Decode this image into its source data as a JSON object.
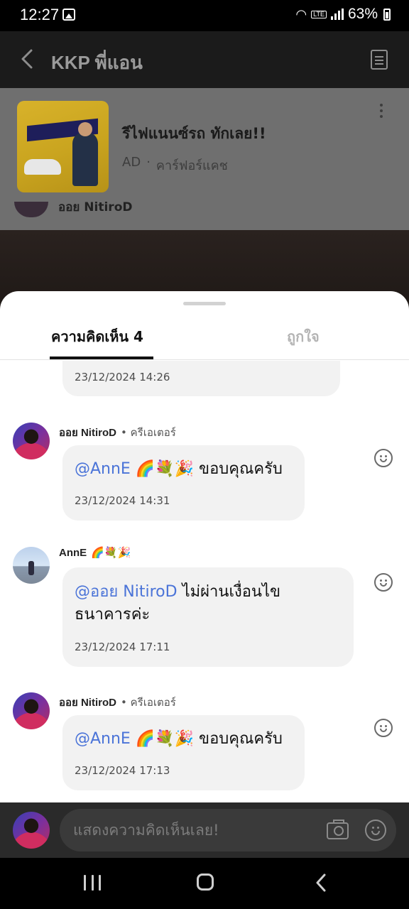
{
  "status_bar": {
    "time": "12:27",
    "network": "LTE",
    "battery": "63%"
  },
  "header": {
    "title": "KKP พี่แอน"
  },
  "ad": {
    "title": "รีไฟแนนซ์รถ ทักเลย!!",
    "label": "AD",
    "separator": "·",
    "advertiser": "คาร์ฟอร์แคช",
    "peek_name": "ออย NitiroD"
  },
  "sheet": {
    "tabs": [
      {
        "label": "ความคิดเห็น 4",
        "active": true
      },
      {
        "label": "ถูกใจ",
        "active": false
      }
    ]
  },
  "comments": {
    "top_partial": {
      "time": "23/12/2024 14:26"
    },
    "items": [
      {
        "author": "ออย NitiroD",
        "role": "ครีเอเตอร์",
        "mention": "@AnnE",
        "emoji": "🌈💐🎉",
        "text": "ขอบคุณครับ",
        "time": "23/12/2024 14:31"
      },
      {
        "author": "AnnE",
        "author_emoji": "🌈💐🎉",
        "mention": "@ออย NitiroD",
        "text": "ไม่ผ่านเงื่อนไข",
        "text_line2": "ธนาคารค่ะ",
        "time": "23/12/2024 17:11"
      },
      {
        "author": "ออย NitiroD",
        "role": "ครีเอเตอร์",
        "mention": "@AnnE",
        "emoji": "🌈💐🎉",
        "text": "ขอบคุณครับ",
        "time": "23/12/2024 17:13"
      }
    ]
  },
  "input": {
    "placeholder": "แสดงความคิดเห็นเลย!"
  }
}
